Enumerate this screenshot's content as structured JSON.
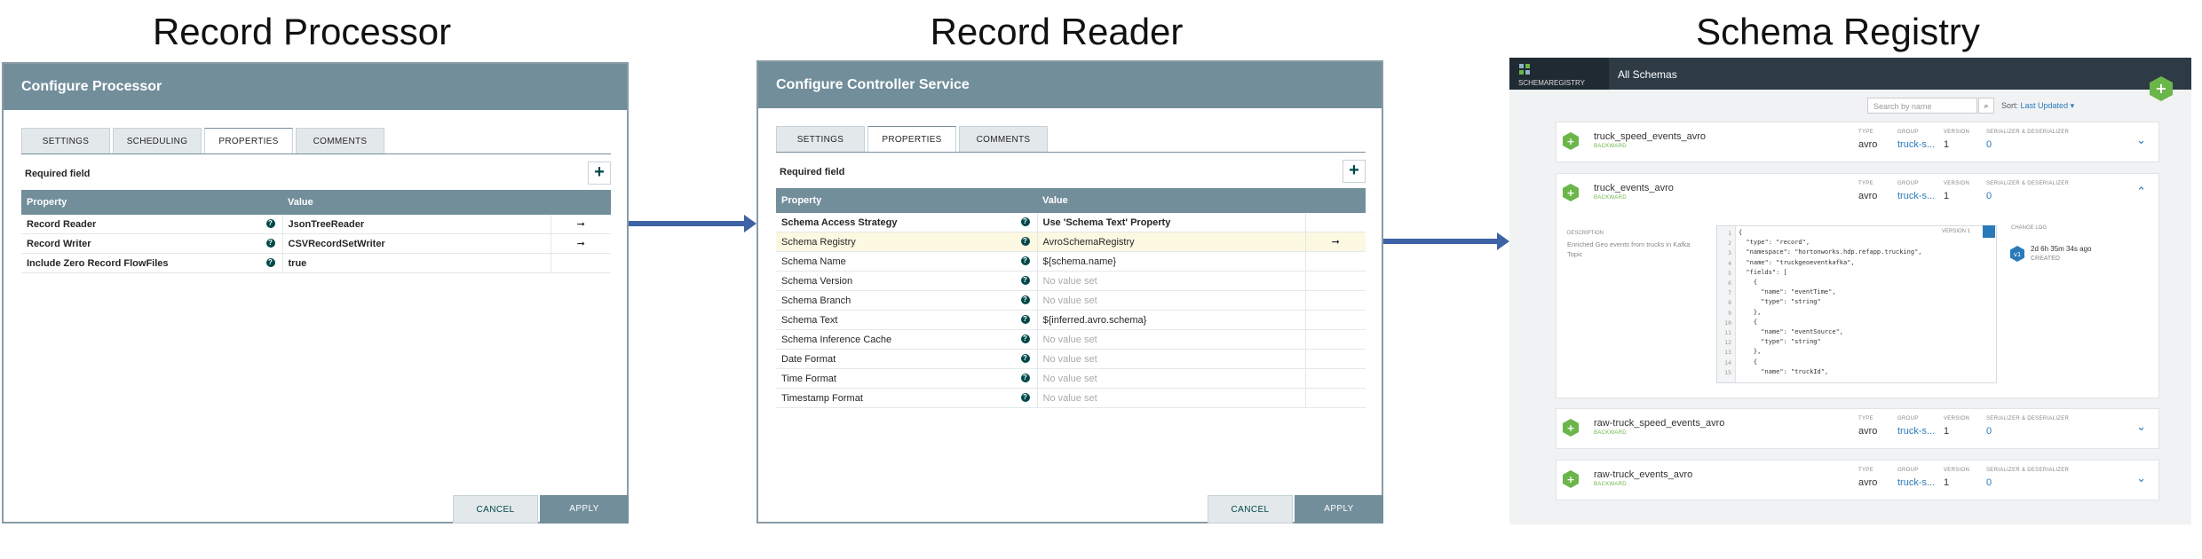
{
  "titles": {
    "processor": "Record Processor",
    "reader": "Record Reader",
    "registry": "Schema Registry"
  },
  "processor_dialog": {
    "header": "Configure Processor",
    "tabs": [
      "SETTINGS",
      "SCHEDULING",
      "PROPERTIES",
      "COMMENTS"
    ],
    "active_tab": "PROPERTIES",
    "required_field": "Required field",
    "add_symbol": "+",
    "columns": {
      "property": "Property",
      "value": "Value"
    },
    "rows": [
      {
        "name": "Record Reader",
        "value": "JsonTreeReader",
        "arrow": "➞"
      },
      {
        "name": "Record Writer",
        "value": "CSVRecordSetWriter",
        "arrow": "➞"
      },
      {
        "name": "Include Zero Record FlowFiles",
        "value": "true",
        "arrow": ""
      }
    ],
    "cancel": "CANCEL",
    "apply": "APPLY"
  },
  "reader_dialog": {
    "header": "Configure Controller Service",
    "tabs": [
      "SETTINGS",
      "PROPERTIES",
      "COMMENTS"
    ],
    "active_tab": "PROPERTIES",
    "required_field": "Required field",
    "add_symbol": "+",
    "columns": {
      "property": "Property",
      "value": "Value"
    },
    "rows": [
      {
        "name": "Schema Access Strategy",
        "value": "Use 'Schema Text' Property",
        "arrow": ""
      },
      {
        "name": "Schema Registry",
        "value": "AvroSchemaRegistry",
        "arrow": "➞"
      },
      {
        "name": "Schema Name",
        "value": "${schema.name}",
        "arrow": ""
      },
      {
        "name": "Schema Version",
        "value": "No value set",
        "arrow": ""
      },
      {
        "name": "Schema Branch",
        "value": "No value set",
        "arrow": ""
      },
      {
        "name": "Schema Text",
        "value": "${inferred.avro.schema}",
        "arrow": ""
      },
      {
        "name": "Schema Inference Cache",
        "value": "No value set",
        "arrow": ""
      },
      {
        "name": "Date Format",
        "value": "No value set",
        "arrow": ""
      },
      {
        "name": "Time Format",
        "value": "No value set",
        "arrow": ""
      },
      {
        "name": "Timestamp Format",
        "value": "No value set",
        "arrow": ""
      }
    ],
    "cancel": "CANCEL",
    "apply": "APPLY"
  },
  "registry": {
    "brand": "SCHEMAREGISTRY",
    "section_title": "All Schemas",
    "search_placeholder": "Search by name",
    "sort_label": "Sort:",
    "sort_value": "Last Updated ▾",
    "col_labels": {
      "type": "TYPE",
      "group": "GROUP",
      "version": "VERSION",
      "serdes": "SERIALIZER & DESERIALIZER"
    },
    "schemas": [
      {
        "name": "truck_speed_events_avro",
        "badge": "BACKWARD",
        "type": "avro",
        "group": "truck-s...",
        "version": "1",
        "serdes": "0",
        "chevron": "⌄"
      },
      {
        "name": "truck_events_avro",
        "badge": "BACKWARD",
        "type": "avro",
        "group": "truck-s...",
        "version": "1",
        "serdes": "0",
        "chevron": "⌃"
      },
      {
        "name": "raw-truck_speed_events_avro",
        "badge": "BACKWARD",
        "type": "avro",
        "group": "truck-s...",
        "version": "1",
        "serdes": "0",
        "chevron": "⌄"
      },
      {
        "name": "raw-truck_events_avro",
        "badge": "BACKWARD",
        "type": "avro",
        "group": "truck-s...",
        "version": "1",
        "serdes": "0",
        "chevron": "⌄"
      }
    ],
    "expanded": {
      "description_label": "DESCRIPTION",
      "description": "Enriched Geo events from trucks in Kafka Topic",
      "version_label": "VERSION 1",
      "changelog_label": "CHANGE LOG",
      "changelog_badge": "v1",
      "changelog_time": "2d 6h 35m 34s ago",
      "changelog_status": "CREATED",
      "code_lines": [
        "{",
        "  \"type\": \"record\",",
        "  \"namespace\": \"hortonworks.hdp.refapp.trucking\",",
        "  \"name\": \"truckgeoeventkafka\",",
        "  \"fields\": [",
        "    {",
        "      \"name\": \"eventTime\",",
        "      \"type\": \"string\"",
        "    },",
        "    {",
        "      \"name\": \"eventSource\",",
        "      \"type\": \"string\"",
        "    },",
        "    {",
        "      \"name\": \"truckId\","
      ]
    },
    "colors": {
      "accent": "#6bb64a",
      "link": "#2a7ab9",
      "header": "#2e3b45"
    }
  }
}
